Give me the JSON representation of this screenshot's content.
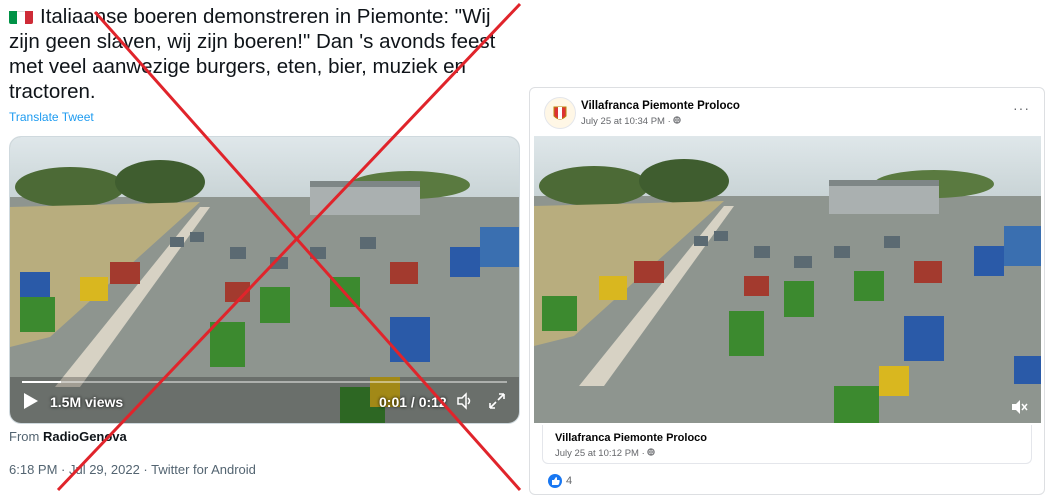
{
  "tweet": {
    "text": "Italiaanse boeren demonstreren in Piemonte: \"Wij zijn geen slaven, wij zijn boeren!\" Dan 's avonds feest met veel aanwezige burgers, eten, bier, muziek en tractoren.",
    "translate_label": "Translate Tweet",
    "views": "1.5M views",
    "time": "0:01 / 0:12",
    "progress": 0.08,
    "from_prefix": "From",
    "from_source": "RadioGenova",
    "meta": "6:18 PM · Jul 29, 2022 · Twitter for Android",
    "flag_colors": [
      "#009246",
      "#ffffff",
      "#ce2b37"
    ],
    "cross_color": "#e0242b"
  },
  "facebook": {
    "page_name": "Villafranca Piemonte Proloco",
    "post_time": "July 25 at 10:34 PM · ",
    "card_name": "Villafranca Piemonte Proloco",
    "card_time": "July 25 at 10:12 PM · ",
    "reaction_count": "4",
    "more_icon": "···",
    "like_color": "#1877f2"
  }
}
